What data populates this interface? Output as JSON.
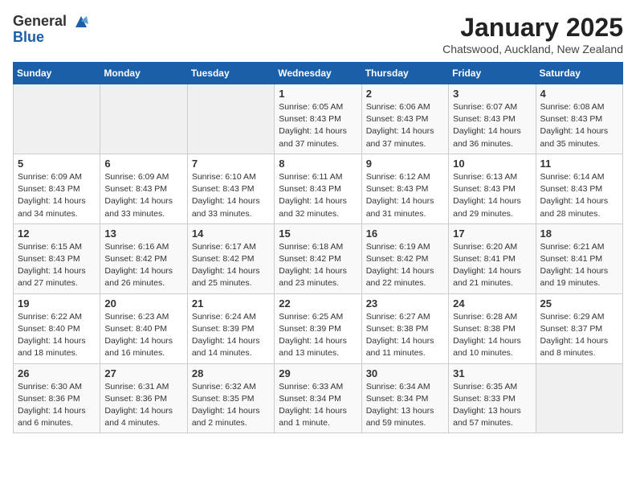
{
  "header": {
    "logo_line1": "General",
    "logo_line2": "Blue",
    "month_title": "January 2025",
    "subtitle": "Chatswood, Auckland, New Zealand"
  },
  "days_of_week": [
    "Sunday",
    "Monday",
    "Tuesday",
    "Wednesday",
    "Thursday",
    "Friday",
    "Saturday"
  ],
  "weeks": [
    [
      {
        "day": "",
        "info": ""
      },
      {
        "day": "",
        "info": ""
      },
      {
        "day": "",
        "info": ""
      },
      {
        "day": "1",
        "info": "Sunrise: 6:05 AM\nSunset: 8:43 PM\nDaylight: 14 hours\nand 37 minutes."
      },
      {
        "day": "2",
        "info": "Sunrise: 6:06 AM\nSunset: 8:43 PM\nDaylight: 14 hours\nand 37 minutes."
      },
      {
        "day": "3",
        "info": "Sunrise: 6:07 AM\nSunset: 8:43 PM\nDaylight: 14 hours\nand 36 minutes."
      },
      {
        "day": "4",
        "info": "Sunrise: 6:08 AM\nSunset: 8:43 PM\nDaylight: 14 hours\nand 35 minutes."
      }
    ],
    [
      {
        "day": "5",
        "info": "Sunrise: 6:09 AM\nSunset: 8:43 PM\nDaylight: 14 hours\nand 34 minutes."
      },
      {
        "day": "6",
        "info": "Sunrise: 6:09 AM\nSunset: 8:43 PM\nDaylight: 14 hours\nand 33 minutes."
      },
      {
        "day": "7",
        "info": "Sunrise: 6:10 AM\nSunset: 8:43 PM\nDaylight: 14 hours\nand 33 minutes."
      },
      {
        "day": "8",
        "info": "Sunrise: 6:11 AM\nSunset: 8:43 PM\nDaylight: 14 hours\nand 32 minutes."
      },
      {
        "day": "9",
        "info": "Sunrise: 6:12 AM\nSunset: 8:43 PM\nDaylight: 14 hours\nand 31 minutes."
      },
      {
        "day": "10",
        "info": "Sunrise: 6:13 AM\nSunset: 8:43 PM\nDaylight: 14 hours\nand 29 minutes."
      },
      {
        "day": "11",
        "info": "Sunrise: 6:14 AM\nSunset: 8:43 PM\nDaylight: 14 hours\nand 28 minutes."
      }
    ],
    [
      {
        "day": "12",
        "info": "Sunrise: 6:15 AM\nSunset: 8:43 PM\nDaylight: 14 hours\nand 27 minutes."
      },
      {
        "day": "13",
        "info": "Sunrise: 6:16 AM\nSunset: 8:42 PM\nDaylight: 14 hours\nand 26 minutes."
      },
      {
        "day": "14",
        "info": "Sunrise: 6:17 AM\nSunset: 8:42 PM\nDaylight: 14 hours\nand 25 minutes."
      },
      {
        "day": "15",
        "info": "Sunrise: 6:18 AM\nSunset: 8:42 PM\nDaylight: 14 hours\nand 23 minutes."
      },
      {
        "day": "16",
        "info": "Sunrise: 6:19 AM\nSunset: 8:42 PM\nDaylight: 14 hours\nand 22 minutes."
      },
      {
        "day": "17",
        "info": "Sunrise: 6:20 AM\nSunset: 8:41 PM\nDaylight: 14 hours\nand 21 minutes."
      },
      {
        "day": "18",
        "info": "Sunrise: 6:21 AM\nSunset: 8:41 PM\nDaylight: 14 hours\nand 19 minutes."
      }
    ],
    [
      {
        "day": "19",
        "info": "Sunrise: 6:22 AM\nSunset: 8:40 PM\nDaylight: 14 hours\nand 18 minutes."
      },
      {
        "day": "20",
        "info": "Sunrise: 6:23 AM\nSunset: 8:40 PM\nDaylight: 14 hours\nand 16 minutes."
      },
      {
        "day": "21",
        "info": "Sunrise: 6:24 AM\nSunset: 8:39 PM\nDaylight: 14 hours\nand 14 minutes."
      },
      {
        "day": "22",
        "info": "Sunrise: 6:25 AM\nSunset: 8:39 PM\nDaylight: 14 hours\nand 13 minutes."
      },
      {
        "day": "23",
        "info": "Sunrise: 6:27 AM\nSunset: 8:38 PM\nDaylight: 14 hours\nand 11 minutes."
      },
      {
        "day": "24",
        "info": "Sunrise: 6:28 AM\nSunset: 8:38 PM\nDaylight: 14 hours\nand 10 minutes."
      },
      {
        "day": "25",
        "info": "Sunrise: 6:29 AM\nSunset: 8:37 PM\nDaylight: 14 hours\nand 8 minutes."
      }
    ],
    [
      {
        "day": "26",
        "info": "Sunrise: 6:30 AM\nSunset: 8:36 PM\nDaylight: 14 hours\nand 6 minutes."
      },
      {
        "day": "27",
        "info": "Sunrise: 6:31 AM\nSunset: 8:36 PM\nDaylight: 14 hours\nand 4 minutes."
      },
      {
        "day": "28",
        "info": "Sunrise: 6:32 AM\nSunset: 8:35 PM\nDaylight: 14 hours\nand 2 minutes."
      },
      {
        "day": "29",
        "info": "Sunrise: 6:33 AM\nSunset: 8:34 PM\nDaylight: 14 hours\nand 1 minute."
      },
      {
        "day": "30",
        "info": "Sunrise: 6:34 AM\nSunset: 8:34 PM\nDaylight: 13 hours\nand 59 minutes."
      },
      {
        "day": "31",
        "info": "Sunrise: 6:35 AM\nSunset: 8:33 PM\nDaylight: 13 hours\nand 57 minutes."
      },
      {
        "day": "",
        "info": ""
      }
    ]
  ]
}
